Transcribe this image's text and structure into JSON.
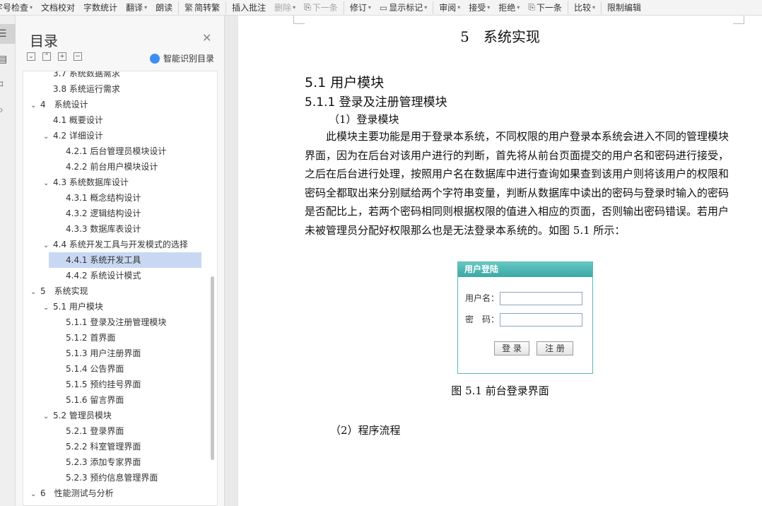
{
  "toolbar": {
    "items": [
      {
        "label": "字号检查",
        "caret": true,
        "disabled": false
      },
      {
        "label": "文档校对",
        "caret": false,
        "disabled": false
      },
      {
        "label": "字数统计",
        "caret": false,
        "disabled": false
      },
      {
        "label": "翻译",
        "caret": true,
        "disabled": false
      },
      {
        "label": "朗读",
        "caret": false,
        "disabled": false
      },
      {
        "label": "简转繁",
        "caret": false,
        "disabled": false,
        "icon": "繁"
      },
      {
        "label": "插入批注",
        "caret": false,
        "disabled": false
      },
      {
        "label": "删除",
        "caret": true,
        "disabled": true
      },
      {
        "label": "下一条",
        "caret": false,
        "disabled": true,
        "icon": "⎘"
      },
      {
        "label": "修订",
        "caret": true,
        "disabled": false
      },
      {
        "label": "显示标记",
        "caret": true,
        "disabled": false,
        "icon": "▭"
      },
      {
        "label": "审阅",
        "caret": true,
        "disabled": false
      },
      {
        "label": "接受",
        "caret": true,
        "disabled": false
      },
      {
        "label": "拒绝",
        "caret": true,
        "disabled": false
      },
      {
        "label": "下一条",
        "caret": false,
        "disabled": false,
        "icon": "⎘"
      },
      {
        "label": "比较",
        "caret": true,
        "disabled": false
      },
      {
        "label": "限制编辑",
        "caret": false,
        "disabled": false
      }
    ]
  },
  "toc": {
    "title": "目录",
    "smart_label": "智能识别目录",
    "items": [
      {
        "text": "3.7 系统数据需求",
        "level": 2,
        "toggle": ""
      },
      {
        "text": "3.8 系统运行需求",
        "level": 2,
        "toggle": ""
      },
      {
        "text": "4　系统设计",
        "level": 1,
        "toggle": "v"
      },
      {
        "text": "4.1 概要设计",
        "level": 2,
        "toggle": ""
      },
      {
        "text": "4.2 详细设计",
        "level": 2,
        "toggle": "v"
      },
      {
        "text": "4.2.1 后台管理员模块设计",
        "level": 3,
        "toggle": ""
      },
      {
        "text": "4.2.2 前台用户模块设计",
        "level": 3,
        "toggle": ""
      },
      {
        "text": "4.3 系统数据库设计",
        "level": 2,
        "toggle": "v"
      },
      {
        "text": "4.3.1 概念结构设计",
        "level": 3,
        "toggle": ""
      },
      {
        "text": "4.3.2 逻辑结构设计",
        "level": 3,
        "toggle": ""
      },
      {
        "text": "4.3.3 数据库表设计",
        "level": 3,
        "toggle": ""
      },
      {
        "text": "4.4 系统开发工具与开发模式的选择",
        "level": 2,
        "toggle": "v"
      },
      {
        "text": "4.4.1 系统开发工具",
        "level": 3,
        "toggle": "",
        "selected": true
      },
      {
        "text": "4.4.2 系统设计模式",
        "level": 3,
        "toggle": ""
      },
      {
        "text": "5　系统实现",
        "level": 1,
        "toggle": "v"
      },
      {
        "text": "5.1 用户模块",
        "level": 2,
        "toggle": "v"
      },
      {
        "text": "5.1.1 登录及注册管理模块",
        "level": 3,
        "toggle": ""
      },
      {
        "text": "5.1.2 首界面",
        "level": 3,
        "toggle": ""
      },
      {
        "text": "5.1.3 用户注册界面",
        "level": 3,
        "toggle": ""
      },
      {
        "text": "5.1.4 公告界面",
        "level": 3,
        "toggle": ""
      },
      {
        "text": "5.1.5 预约挂号界面",
        "level": 3,
        "toggle": ""
      },
      {
        "text": "5.1.6 留言界面",
        "level": 3,
        "toggle": ""
      },
      {
        "text": "5.2 管理员模块",
        "level": 2,
        "toggle": "v"
      },
      {
        "text": "5.2.1 登录界面",
        "level": 3,
        "toggle": ""
      },
      {
        "text": "5.2.2 科室管理界面",
        "level": 3,
        "toggle": ""
      },
      {
        "text": "5.2.3 添加专家界面",
        "level": 3,
        "toggle": ""
      },
      {
        "text": "5.2.3 预约信息管理界面",
        "level": 3,
        "toggle": ""
      },
      {
        "text": "6　性能测试与分析",
        "level": 1,
        "toggle": "v"
      }
    ]
  },
  "document": {
    "chapter_title": "5　系统实现",
    "section": "5.1 用户模块",
    "subsection": "5.1.1 登录及注册管理模块",
    "item1": "（1）登录模块",
    "paragraph": "此模块主要功能是用于登录本系统，不同权限的用户登录本系统会进入不同的管理模块界面，因为在后台对该用户进行的判断，首先将从前台页面提交的用户名和密码进行接受，之后在后台进行处理，按照用户名在数据库中进行查询如果查到该用户则将该用户的权限和密码全都取出来分别赋给两个字符串变量，判断从数据库中读出的密码与登录时输入的密码是否配比上，若两个密码相同则根据权限的值进入相应的页面，否则输出密码错误。若用户未被管理员分配好权限那么也是无法登录本系统的。如图 5.1 所示：",
    "figure": {
      "header": "用户登陆",
      "username_label": "用户名：",
      "password_label": "密　码：",
      "login_button": "登 录",
      "register_button": "注 册"
    },
    "caption": "图 5.1 前台登录界面",
    "item2": "（2）程序流程"
  },
  "colors": {
    "selected_row": "#c9d8f2",
    "figure_header": "#3aa8a6",
    "smart_icon": "#3b8ff0"
  }
}
